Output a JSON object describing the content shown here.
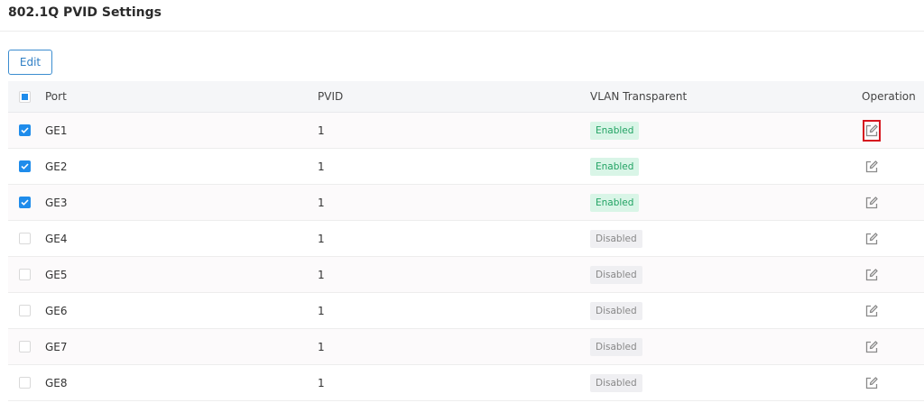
{
  "page": {
    "title": "802.1Q PVID Settings"
  },
  "toolbar": {
    "edit_label": "Edit"
  },
  "table": {
    "columns": {
      "port": "Port",
      "pvid": "PVID",
      "vlan_transparent": "VLAN Transparent",
      "operation": "Operation"
    },
    "rows": [
      {
        "port": "GE1",
        "pvid": "1",
        "vlan_transparent": "Enabled",
        "status": "enabled",
        "checked": true,
        "highlighted": true
      },
      {
        "port": "GE2",
        "pvid": "1",
        "vlan_transparent": "Enabled",
        "status": "enabled",
        "checked": true,
        "highlighted": false
      },
      {
        "port": "GE3",
        "pvid": "1",
        "vlan_transparent": "Enabled",
        "status": "enabled",
        "checked": true,
        "highlighted": false
      },
      {
        "port": "GE4",
        "pvid": "1",
        "vlan_transparent": "Disabled",
        "status": "disabled",
        "checked": false,
        "highlighted": false
      },
      {
        "port": "GE5",
        "pvid": "1",
        "vlan_transparent": "Disabled",
        "status": "disabled",
        "checked": false,
        "highlighted": false
      },
      {
        "port": "GE6",
        "pvid": "1",
        "vlan_transparent": "Disabled",
        "status": "disabled",
        "checked": false,
        "highlighted": false
      },
      {
        "port": "GE7",
        "pvid": "1",
        "vlan_transparent": "Disabled",
        "status": "disabled",
        "checked": false,
        "highlighted": false
      },
      {
        "port": "GE8",
        "pvid": "1",
        "vlan_transparent": "Disabled",
        "status": "disabled",
        "checked": false,
        "highlighted": false
      }
    ]
  },
  "colors": {
    "accent": "#1f8ceb",
    "enabled_text": "#23a364",
    "enabled_bg": "#d9f5e7",
    "disabled_bg": "#efeff2",
    "highlight": "#d6161f"
  },
  "icons": {
    "edit": "edit-icon"
  }
}
